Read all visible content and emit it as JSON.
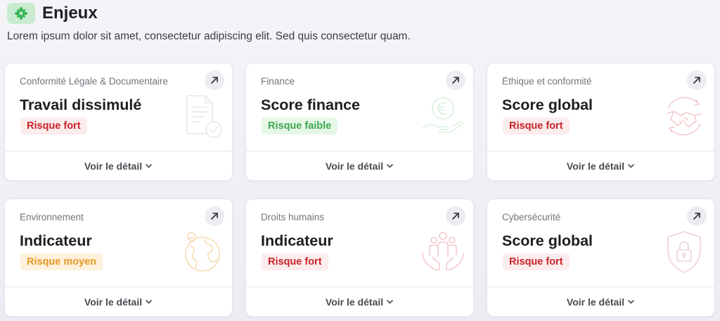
{
  "header": {
    "title": "Enjeux",
    "subtitle": "Lorem ipsum dolor sit amet, consectetur adipiscing elit. Sed quis consectetur quam."
  },
  "colors": {
    "accent_green": "#3fba5a",
    "risk_high": "#c8232b",
    "risk_low": "#3fa650",
    "risk_medium": "#e59a23"
  },
  "cards": [
    {
      "category": "Conformité Légale & Documentaire",
      "title": "Travail dissimulé",
      "risk": "Risque fort",
      "risk_level": "fort",
      "icon": "document-check-icon",
      "detail": "Voir le détail"
    },
    {
      "category": "Finance",
      "title": "Score finance",
      "risk": "Risque faible",
      "risk_level": "faible",
      "icon": "euro-hand-icon",
      "detail": "Voir le détail"
    },
    {
      "category": "Éthique et conformité",
      "title": "Score global",
      "risk": "Risque fort",
      "risk_level": "fort",
      "icon": "handshake-icon",
      "detail": "Voir le détail"
    },
    {
      "category": "Environnement",
      "title": "Indicateur",
      "risk": "Risque moyen",
      "risk_level": "moyen",
      "icon": "globe-leaf-icon",
      "detail": "Voir le détail"
    },
    {
      "category": "Droits humains",
      "title": "Indicateur",
      "risk": "Risque fort",
      "risk_level": "fort",
      "icon": "people-hands-icon",
      "detail": "Voir le détail"
    },
    {
      "category": "Cybersécurité",
      "title": "Score global",
      "risk": "Risque fort",
      "risk_level": "fort",
      "icon": "shield-lock-icon",
      "detail": "Voir le détail"
    }
  ]
}
